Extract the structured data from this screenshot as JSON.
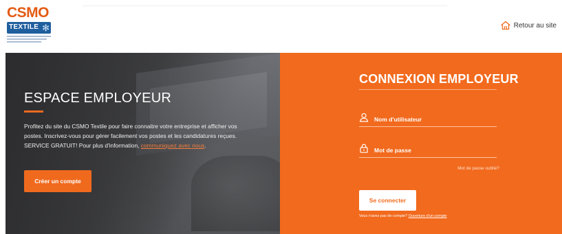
{
  "header": {
    "logo_text": "CSMO",
    "logo_badge_text": "TEXTILE",
    "retour_label": "Retour au site"
  },
  "left": {
    "title": "ESPACE EMPLOYEUR",
    "description": "Profitez du site du CSMO Textile pour faire connaitre votre entreprise et afficher vos postes. Inscrivez-vous pour gérer facilement vos postes et les candidatures reçues. SERVICE GRATUIT! Pour plus d'information, ",
    "link_text": "communiquez avec nous",
    "link_suffix": ".",
    "create_button": "Créer un compte"
  },
  "right": {
    "title": "CONNEXION EMPLOYEUR",
    "username_placeholder": "Nom d'utilisateur",
    "password_placeholder": "Mot de passe",
    "forgot_link": "Mot de passe oublié?",
    "login_button": "Se connecter",
    "no_account_text": "Vous n'avez pas de compte?",
    "open_account_link": "Ouverture d'un compte"
  },
  "colors": {
    "accent": "#f26a1d",
    "logo_orange": "#e35a13",
    "logo_blue": "#1f5f9e"
  },
  "icons": {
    "home": "home-icon",
    "user": "user-icon",
    "lock": "lock-icon"
  }
}
